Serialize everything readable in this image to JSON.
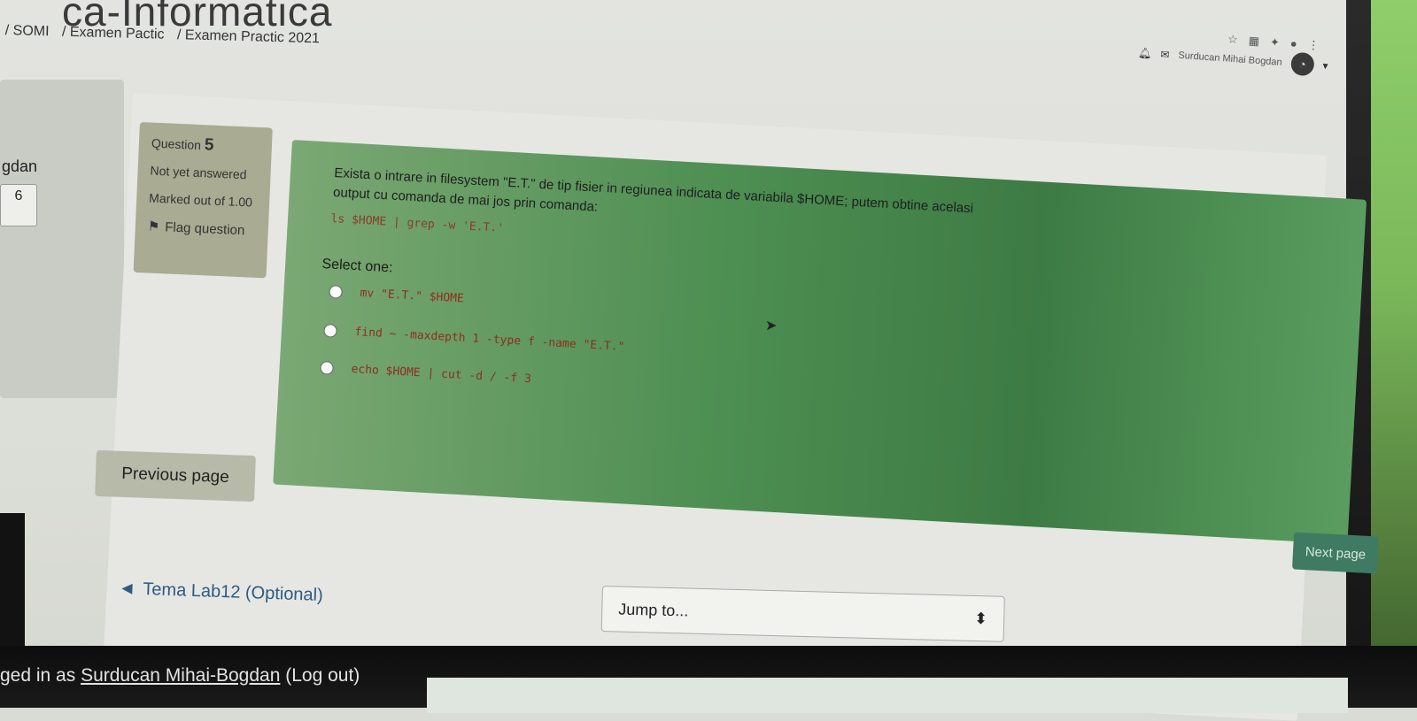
{
  "site": {
    "title": "ca-Informatica"
  },
  "breadcrumb": [
    "/ SOMI",
    "/ Examen Pactic",
    "/ Examen Practic 2021"
  ],
  "user": {
    "name": "Surducan Mihai Bogdan"
  },
  "left_nav": {
    "name_fragment": "gdan",
    "current_question": "6"
  },
  "question": {
    "label": "Question",
    "number": "5",
    "status": "Not yet answered",
    "marked_out_of": "Marked out of 1.00",
    "flag_label": "Flag question",
    "text": "Exista o intrare in filesystem \"E.T.\" de tip fisier in regiunea indicata de variabila $HOME; putem obtine acelasi output cu comanda de mai jos prin comanda:",
    "command": "ls $HOME | grep -w 'E.T.'",
    "select_one": "Select one:",
    "options": [
      "mv \"E.T.\" $HOME",
      "find ~ -maxdepth 1 -type f -name \"E.T.\"",
      "echo $HOME | cut -d / -f 3"
    ]
  },
  "nav": {
    "previous_page": "Previous page",
    "next_page": "Next page",
    "previous_activity": "Tema Lab12 (Optional)",
    "jump_to": "Jump to..."
  },
  "footer": {
    "prefix": "ged in as",
    "user_link": "Surducan Mihai-Bogdan",
    "logout": "(Log out)"
  }
}
